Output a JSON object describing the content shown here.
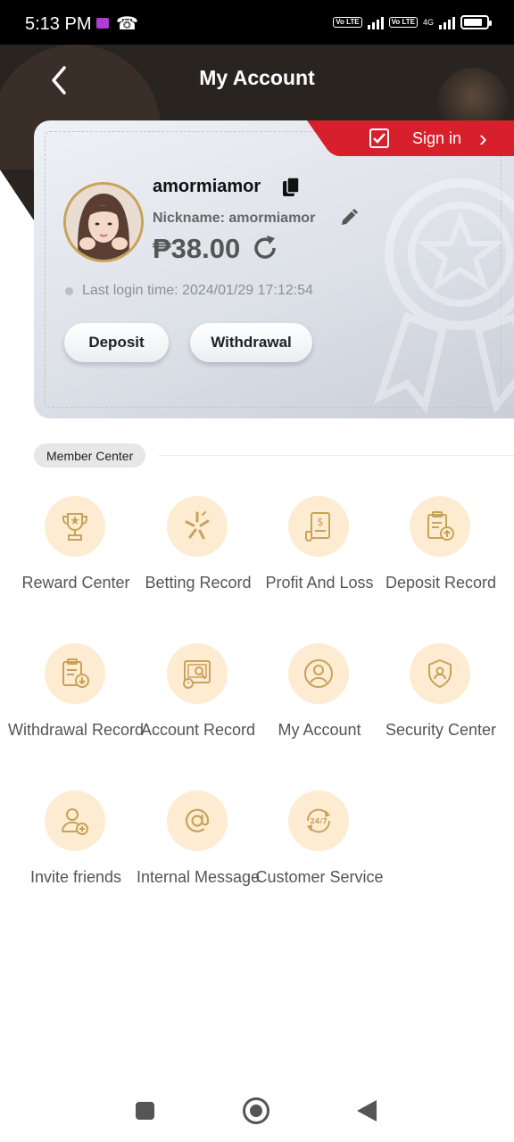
{
  "status_bar": {
    "time": "5:13 PM",
    "volte_1": "Vo LTE",
    "volte_2": "Vo LTE",
    "network": "4G",
    "battery_level": 0.85
  },
  "header": {
    "title": "My Account"
  },
  "account": {
    "sign_in_label": "Sign in",
    "username": "amormiamor",
    "nickname": "Nickname: amormiamor",
    "balance": "₱38.00",
    "last_login": "Last login time: 2024/01/29 17:12:54",
    "deposit_label": "Deposit",
    "withdrawal_label": "Withdrawal"
  },
  "member_center": {
    "title": "Member Center",
    "items": [
      {
        "label": "Reward Center",
        "icon": "trophy-icon"
      },
      {
        "label": "Betting Record",
        "icon": "sparkle-icon"
      },
      {
        "label": "Profit And Loss",
        "icon": "receipt-dollar-icon"
      },
      {
        "label": "Deposit Record",
        "icon": "clipboard-upload-icon"
      },
      {
        "label": "Withdrawal Record",
        "icon": "clipboard-download-icon"
      },
      {
        "label": "Account Record",
        "icon": "account-record-icon"
      },
      {
        "label": "My Account",
        "icon": "user-circle-icon"
      },
      {
        "label": "Security Center",
        "icon": "shield-user-icon"
      },
      {
        "label": "Invite friends",
        "icon": "user-add-icon"
      },
      {
        "label": "Internal Message",
        "icon": "at-sign-icon"
      },
      {
        "label": "Customer Service",
        "icon": "support-24-7-icon"
      }
    ]
  },
  "colors": {
    "header_bg": "#2a2421",
    "sign_in_red": "#d8202c",
    "icon_circle": "#fdecd2",
    "icon_gold": "#c9a25a"
  }
}
